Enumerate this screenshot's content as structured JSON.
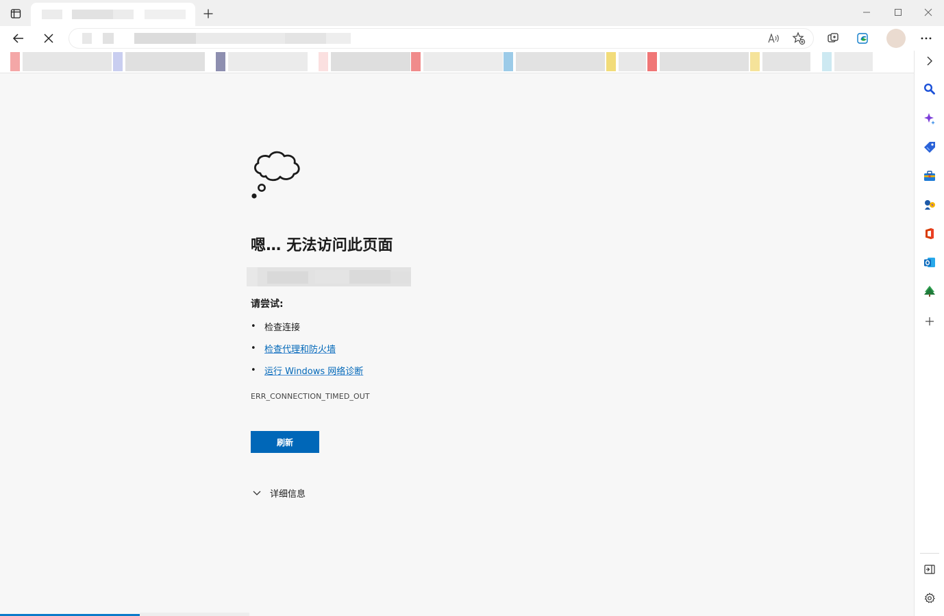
{
  "browser": {
    "tab": {
      "title": ""
    },
    "address": {
      "url": ""
    },
    "icons": {
      "tab_actions": "tab-actions-icon",
      "new_tab": "plus-icon",
      "minimize": "minimize-icon",
      "maximize": "maximize-icon",
      "close": "close-icon",
      "back": "back-arrow-icon",
      "stop": "stop-x-icon",
      "read_aloud": "read-aloud-icon",
      "favorite": "add-favorite-icon",
      "collections": "collections-icon",
      "copilot": "copilot-icon",
      "more": "more-dots-icon"
    },
    "favorites_colors": [
      "#f4a7a7",
      "#c9cef0",
      "#8e8fb0",
      "#fbe0e0",
      "#f08b8b",
      "#9ccbe8",
      "#f2dc7a",
      "#f07676",
      "#f5e39a",
      "#cde9f2"
    ]
  },
  "sidebar": {
    "items": [
      {
        "name": "search-icon",
        "color": "#1a50d8"
      },
      {
        "name": "copilot-sparkle-icon",
        "color": "#7a3bd8"
      },
      {
        "name": "shopping-tag-icon",
        "color": "#2a62d8"
      },
      {
        "name": "tools-icon",
        "color": "#1e7ad6"
      },
      {
        "name": "games-icon",
        "color": "#e0a21b"
      },
      {
        "name": "office-icon",
        "color": "#d83b01"
      },
      {
        "name": "outlook-icon",
        "color": "#0f6cbd"
      },
      {
        "name": "tree-icon",
        "color": "#2e9e4f"
      },
      {
        "name": "add-icon",
        "color": "#444444"
      }
    ]
  },
  "error_page": {
    "title": "嗯… 无法访问此页面",
    "host": "",
    "try_label": "请尝试:",
    "suggestions": [
      {
        "text": "检查连接",
        "link": false
      },
      {
        "text": "检查代理和防火墙",
        "link": true
      },
      {
        "text": "运行 Windows 网络诊断",
        "link": true
      }
    ],
    "error_code": "ERR_CONNECTION_TIMED_OUT",
    "refresh_label": "刷新",
    "details_label": "详细信息"
  },
  "theme": {
    "accent": "#0067b8",
    "loading": "#0b7ac9"
  }
}
